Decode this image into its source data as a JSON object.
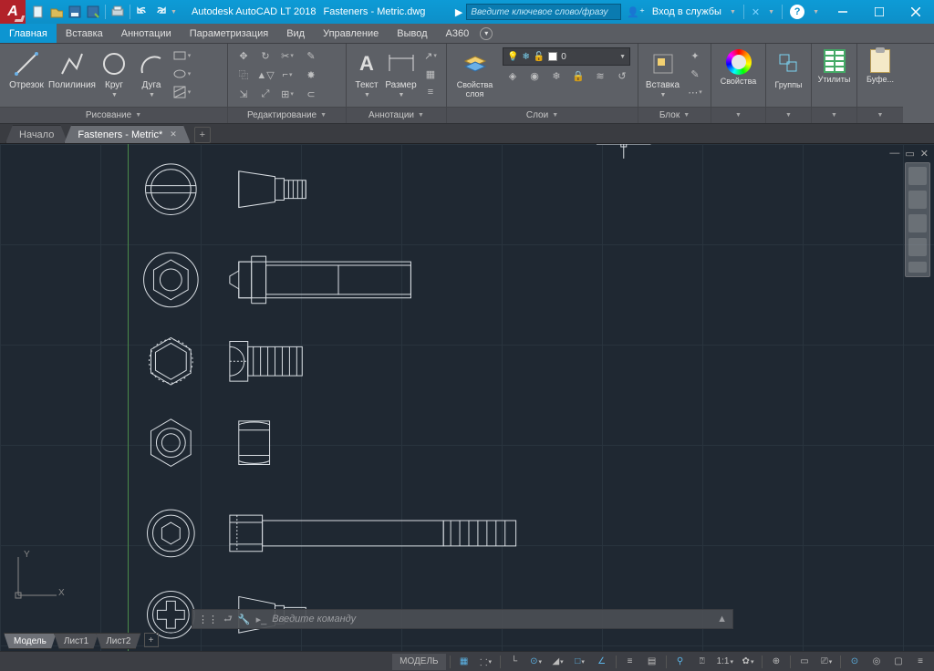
{
  "title": {
    "app": "Autodesk AutoCAD LT 2018",
    "file": "Fasteners - Metric.dwg"
  },
  "search": {
    "placeholder": "Введите ключевое слово/фразу"
  },
  "signin": "Вход в службы",
  "menu": {
    "items": [
      "Главная",
      "Вставка",
      "Аннотации",
      "Параметризация",
      "Вид",
      "Управление",
      "Вывод",
      "A360"
    ]
  },
  "ribbon": {
    "draw": {
      "label": "Рисование",
      "line": "Отрезок",
      "pline": "Полилиния",
      "circle": "Круг",
      "arc": "Дуга"
    },
    "edit": {
      "label": "Редактирование"
    },
    "anno": {
      "label": "Аннотации",
      "text": "Текст",
      "dim": "Размер"
    },
    "layers": {
      "label": "Слои",
      "props": "Свойства слоя",
      "current": "0"
    },
    "block": {
      "label": "Блок",
      "insert": "Вставка"
    },
    "props": {
      "label": "Свойства"
    },
    "groups": {
      "label": "Группы"
    },
    "utils": {
      "label": "Утилиты"
    },
    "clip": {
      "label": "Буфе..."
    }
  },
  "filetabs": {
    "start": "Начало",
    "open": "Fasteners - Metric*"
  },
  "cmd": {
    "placeholder": "Введите команду"
  },
  "layouts": {
    "model": "Модель",
    "l1": "Лист1",
    "l2": "Лист2"
  },
  "status": {
    "model": "МОДЕЛЬ",
    "scale": "1:1"
  },
  "ucs": {
    "x": "X",
    "y": "Y"
  }
}
